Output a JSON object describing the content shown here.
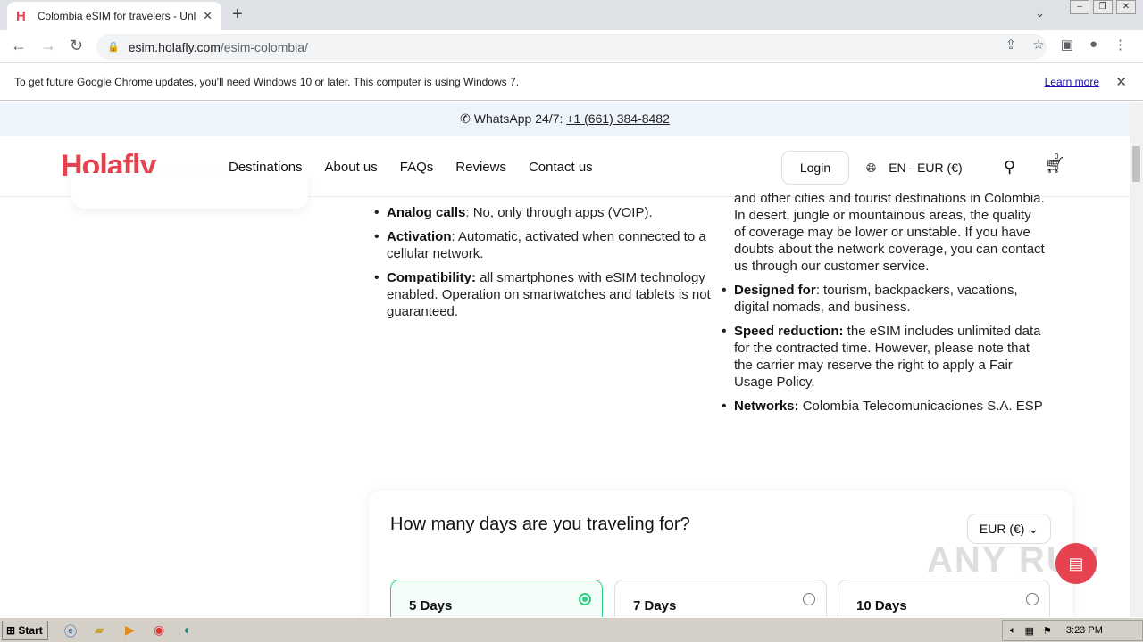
{
  "browser": {
    "tab_title": "Colombia eSIM for travelers - Unlimit",
    "url_host": "esim.holafly.com",
    "url_path": "/esim-colombia/"
  },
  "infobar": {
    "message": "To get future Google Chrome updates, you'll need Windows 10 or later. This computer is using Windows 7.",
    "learn_more": "Learn more"
  },
  "whatsapp": {
    "label": "WhatsApp 24/7:",
    "phone": "+1 (661) 384-8482"
  },
  "site": {
    "logo": "Holafly",
    "nav": [
      "Destinations",
      "About us",
      "FAQs",
      "Reviews",
      "Contact us"
    ],
    "login": "Login",
    "locale": "EN - EUR (€)",
    "cart_count": "0"
  },
  "specs_left": [
    {
      "key": "Analog calls",
      "value": ": No, only through apps (VOIP)."
    },
    {
      "key": "Activation",
      "value": ": Automatic, activated when connected to a cellular network."
    },
    {
      "key": "Compatibility:",
      "value": " all smartphones with eSIM technology enabled. Operation on smartwatches and tablets is not guaranteed."
    }
  ],
  "specs_right_cont": "and other cities and tourist destinations in Colombia. In desert, jungle or mountainous areas, the quality of coverage may be lower or unstable. If you have doubts about the network coverage, you can contact us through our customer service.",
  "specs_right": [
    {
      "key": "Designed for",
      "value": ": tourism, backpackers, vacations, digital nomads, and business."
    },
    {
      "key": "Speed reduction:",
      "value": " the eSIM includes unlimited data for the contracted time. However, please note that the carrier may reserve the right to apply a Fair Usage Policy."
    },
    {
      "key": "Networks:",
      "value": " Colombia Telecomunicaciones S.A. ESP"
    }
  ],
  "days": {
    "title": "How many days are you traveling for?",
    "currency": "EUR (€)",
    "options": [
      "5 Days",
      "7 Days",
      "10 Days"
    ],
    "selected": "5 Days"
  },
  "watermark": "ANY RUN",
  "taskbar": {
    "start": "Start",
    "clock": "3:23 PM"
  },
  "colors": {
    "brand": "#e6424f",
    "selected": "#2fcf83"
  }
}
